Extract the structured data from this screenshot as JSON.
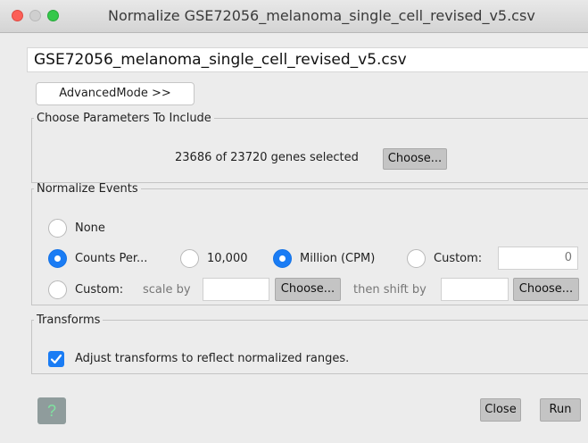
{
  "window": {
    "title": "Normalize GSE72056_melanoma_single_cell_revised_v5.csv"
  },
  "file": {
    "name": "GSE72056_melanoma_single_cell_revised_v5.csv"
  },
  "advanced_mode": {
    "label": "AdvancedMode >>"
  },
  "params": {
    "legend": "Choose Parameters To Include",
    "selection_text": "23686 of 23720 genes selected",
    "choose_label": "Choose..."
  },
  "normalize": {
    "legend": "Normalize Events",
    "none_label": "None",
    "counts_per_label": "Counts Per...",
    "ten_thousand_label": "10,000",
    "million_label": "Million (CPM)",
    "custom_label": "Custom:",
    "custom_value": "0",
    "custom2_label": "Custom:",
    "scale_by_label": "scale by",
    "scale_value": "",
    "choose_scale_label": "Choose...",
    "shift_by_label": "then shift by",
    "shift_value": "",
    "choose_shift_label": "Choose...",
    "selected_option": "Counts Per...",
    "selected_sub_option": "Million (CPM)"
  },
  "transforms": {
    "legend": "Transforms",
    "adjust_label": "Adjust transforms to reflect normalized ranges.",
    "adjust_checked": true
  },
  "footer": {
    "help_label": "?",
    "close_label": "Close",
    "run_label": "Run"
  },
  "colors": {
    "accent": "#1a7cf4",
    "button_gray": "#c4c4c4"
  }
}
